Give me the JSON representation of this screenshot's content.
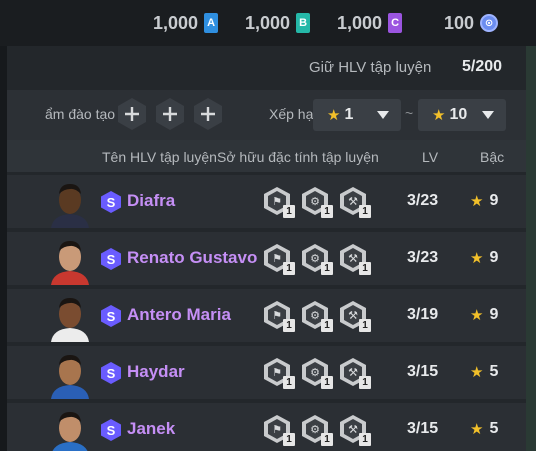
{
  "currencies": [
    {
      "amount": "1,000",
      "letter": "A",
      "color": "#2f8fe0"
    },
    {
      "amount": "1,000",
      "letter": "B",
      "color": "#25b8a8"
    },
    {
      "amount": "1,000",
      "letter": "C",
      "color": "#9b55e0"
    },
    {
      "amount": "100",
      "letter": "⊙",
      "color": "#6b8df0"
    }
  ],
  "hold": {
    "label": "Giữ HLV tập luyện",
    "value": "5/200"
  },
  "filter": {
    "train_label": "ẩm đào tạo",
    "rank_label": "Xếp hạ",
    "rank_from": "1",
    "rank_to": "10",
    "tilde": "~"
  },
  "columns": {
    "name": "Tên HLV tập luyện",
    "traits": "Sở hữu đặc tính tập luyện",
    "lv": "LV",
    "grade": "Bậc"
  },
  "coaches": [
    {
      "name": "Diafra",
      "lv": "3/23",
      "grade": "9",
      "traits": [
        "1",
        "1",
        "1"
      ],
      "skin": "#5a3a22",
      "shirt": "#2a2f45"
    },
    {
      "name": "Renato Gustavo",
      "lv": "3/23",
      "grade": "9",
      "traits": [
        "1",
        "1",
        "1"
      ],
      "skin": "#c99a78",
      "shirt": "#c8382f"
    },
    {
      "name": "Antero Maria",
      "lv": "3/19",
      "grade": "9",
      "traits": [
        "1",
        "1",
        "1"
      ],
      "skin": "#7a4c30",
      "shirt": "#ececec"
    },
    {
      "name": "Haydar",
      "lv": "3/15",
      "grade": "5",
      "traits": [
        "1",
        "1",
        "1"
      ],
      "skin": "#a8754e",
      "shirt": "#2a5fb5"
    },
    {
      "name": "Janek",
      "lv": "3/15",
      "grade": "5",
      "traits": [
        "1",
        "1",
        "1"
      ],
      "skin": "#c08e6a",
      "shirt": "#2a6fc5"
    }
  ],
  "badge_letter": "S",
  "star_glyph": "★"
}
